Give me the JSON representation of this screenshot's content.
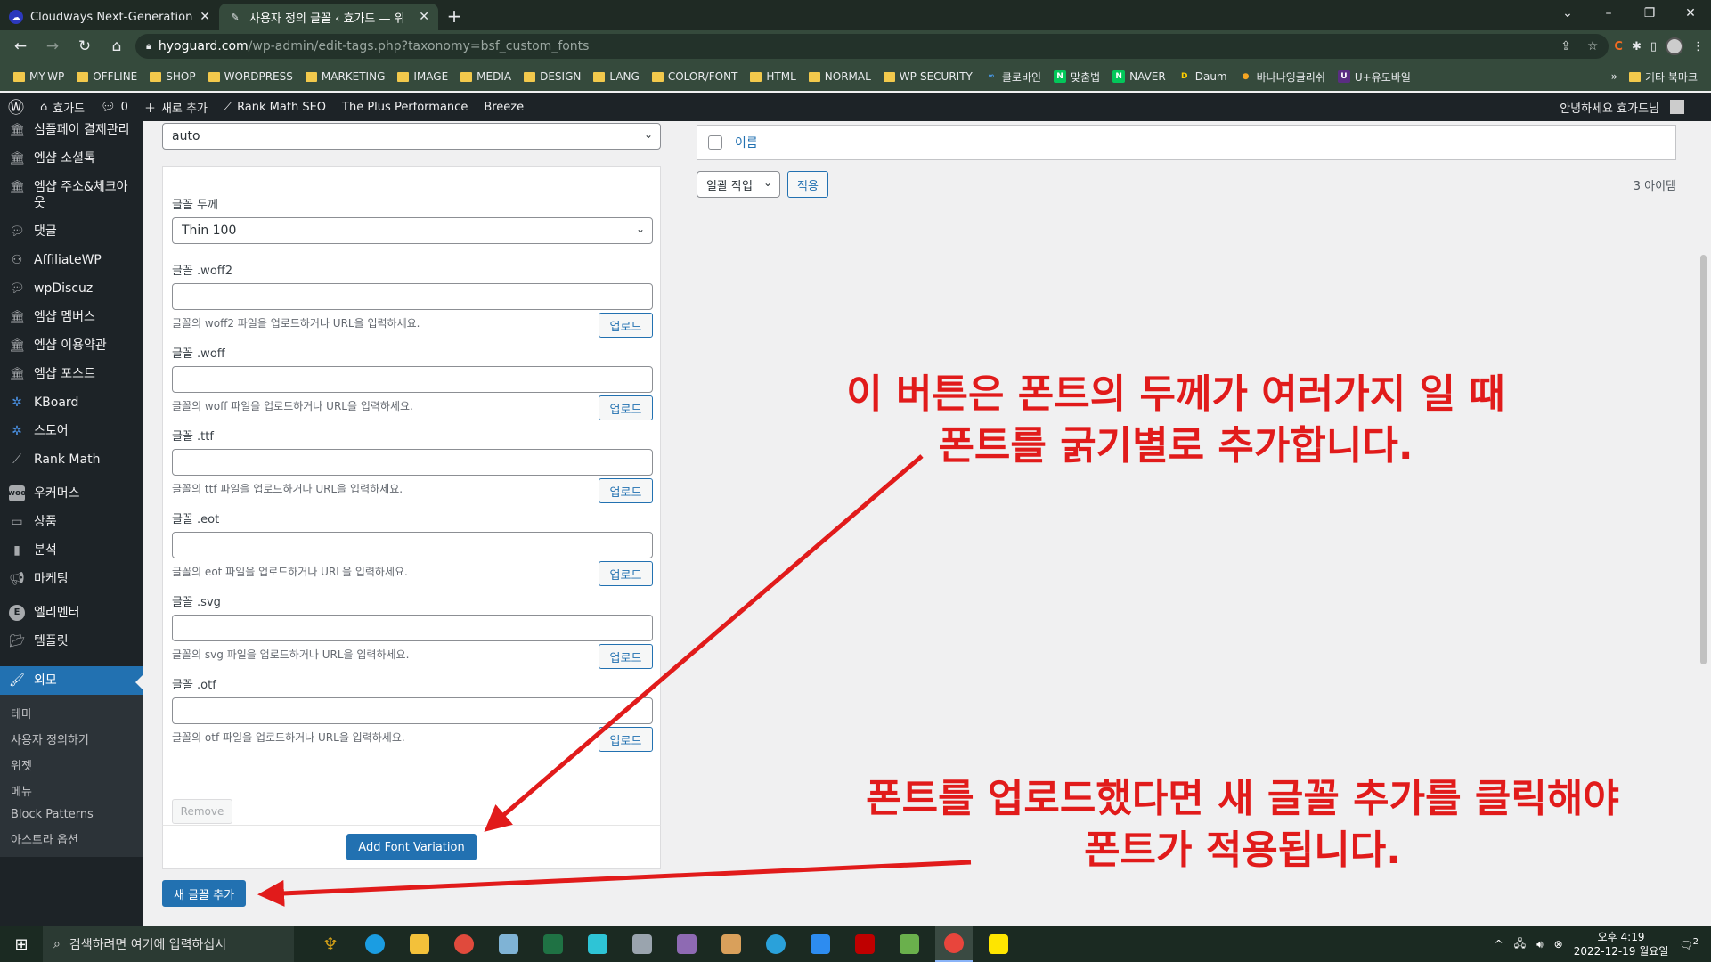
{
  "browser": {
    "tabs": [
      {
        "title": "Cloudways Next-Generation Clo",
        "active": false
      },
      {
        "title": "사용자 정의 글꼴 ‹ 효가드 — 워",
        "active": true
      }
    ],
    "url_host": "hyoguard.com",
    "url_path": "/wp-admin/edit-tags.php?taxonomy=bsf_custom_fonts",
    "bookmarks": [
      "MY-WP",
      "OFFLINE",
      "SHOP",
      "WORDPRESS",
      "MARKETING",
      "IMAGE",
      "MEDIA",
      "DESIGN",
      "LANG",
      "COLOR/FONT",
      "HTML",
      "NORMAL",
      "WP-SECURITY"
    ],
    "bookmark_links": [
      {
        "label": "클로바인",
        "icon": "∞",
        "color": "#4aa3ff"
      },
      {
        "label": "맞춤법",
        "icon": "N",
        "color": "#03c75a"
      },
      {
        "label": "NAVER",
        "icon": "N",
        "color": "#03c75a"
      },
      {
        "label": "Daum",
        "icon": "D",
        "color": "#2f6bff"
      },
      {
        "label": "바나나잉글리쉬",
        "icon": "●",
        "color": "#f5a623"
      },
      {
        "label": "U+유모바일",
        "icon": "U",
        "color": "#5a2d82"
      }
    ],
    "bookmarks_more": "»",
    "other_bookmarks": "기타 북마크"
  },
  "adminbar": {
    "site": "효가드",
    "comments": "0",
    "new": "새로 추가",
    "items": [
      "Rank Math SEO",
      "The Plus Performance",
      "Breeze"
    ],
    "greeting": "안녕하세요 효가드님"
  },
  "sidebar": {
    "items": [
      {
        "label": "심플페이 결제관리",
        "icon": "shop"
      },
      {
        "label": "엠샵 소셜톡",
        "icon": "shop"
      },
      {
        "label": "엠샵 주소&체크아웃",
        "icon": "shop"
      },
      {
        "label": "댓글",
        "icon": "comment"
      },
      {
        "label": "AffiliateWP",
        "icon": "affiliate"
      },
      {
        "label": "wpDiscuz",
        "icon": "comment"
      },
      {
        "label": "엠샵 멤버스",
        "icon": "shop"
      },
      {
        "label": "엠샵 이용약관",
        "icon": "shop"
      },
      {
        "label": "엠샵 포스트",
        "icon": "shop"
      },
      {
        "label": "KBoard",
        "icon": "kboard"
      },
      {
        "label": "스토어",
        "icon": "kboard"
      },
      {
        "label": "Rank Math",
        "icon": "rankmath"
      },
      {
        "label": "우커머스",
        "icon": "woo"
      },
      {
        "label": "상품",
        "icon": "product"
      },
      {
        "label": "분석",
        "icon": "chart"
      },
      {
        "label": "마케팅",
        "icon": "megaphone"
      },
      {
        "label": "엘리멘터",
        "icon": "elementor"
      },
      {
        "label": "템플릿",
        "icon": "folder"
      }
    ],
    "current": "외모",
    "submenu": [
      "테마",
      "사용자 정의하기",
      "위젯",
      "메뉴",
      "Block Patterns",
      "아스트라 옵션"
    ]
  },
  "form": {
    "display_value": "auto",
    "weight_label": "글꼴 두께",
    "weight_value": "Thin 100",
    "fields": [
      {
        "label": "글꼴 .woff2",
        "help": "글꼴의 woff2 파일을 업로드하거나 URL을 입력하세요."
      },
      {
        "label": "글꼴 .woff",
        "help": "글꼴의 woff 파일을 업로드하거나 URL을 입력하세요."
      },
      {
        "label": "글꼴 .ttf",
        "help": "글꼴의 ttf 파일을 업로드하거나 URL을 입력하세요."
      },
      {
        "label": "글꼴 .eot",
        "help": "글꼴의 eot 파일을 업로드하거나 URL을 입력하세요."
      },
      {
        "label": "글꼴 .svg",
        "help": "글꼴의 svg 파일을 업로드하거나 URL을 입력하세요."
      },
      {
        "label": "글꼴 .otf",
        "help": "글꼴의 otf 파일을 업로드하거나 URL을 입력하세요."
      }
    ],
    "upload_label": "업로드",
    "remove_label": "Remove",
    "add_variation_label": "Add Font Variation",
    "add_font_label": "새 글꼴 추가"
  },
  "table": {
    "name_header": "이름",
    "bulk_action": "일괄 작업",
    "apply": "적용",
    "count": "3 아이템"
  },
  "annotations": {
    "top_line1": "이 버튼은 폰트의 두께가 여러가지 일 때",
    "top_line2": "폰트를 굵기별로 추가합니다.",
    "bottom_line1": "폰트를 업로드했다면 새 글꼴 추가를 클릭해야",
    "bottom_line2": "폰트가 적용됩니다.",
    "color": "#e11b1b"
  },
  "taskbar": {
    "search_placeholder": "검색하려면 여기에 입력하십시",
    "time": "오후 4:19",
    "date": "2022-12-19 월요일",
    "notification_count": "2"
  }
}
